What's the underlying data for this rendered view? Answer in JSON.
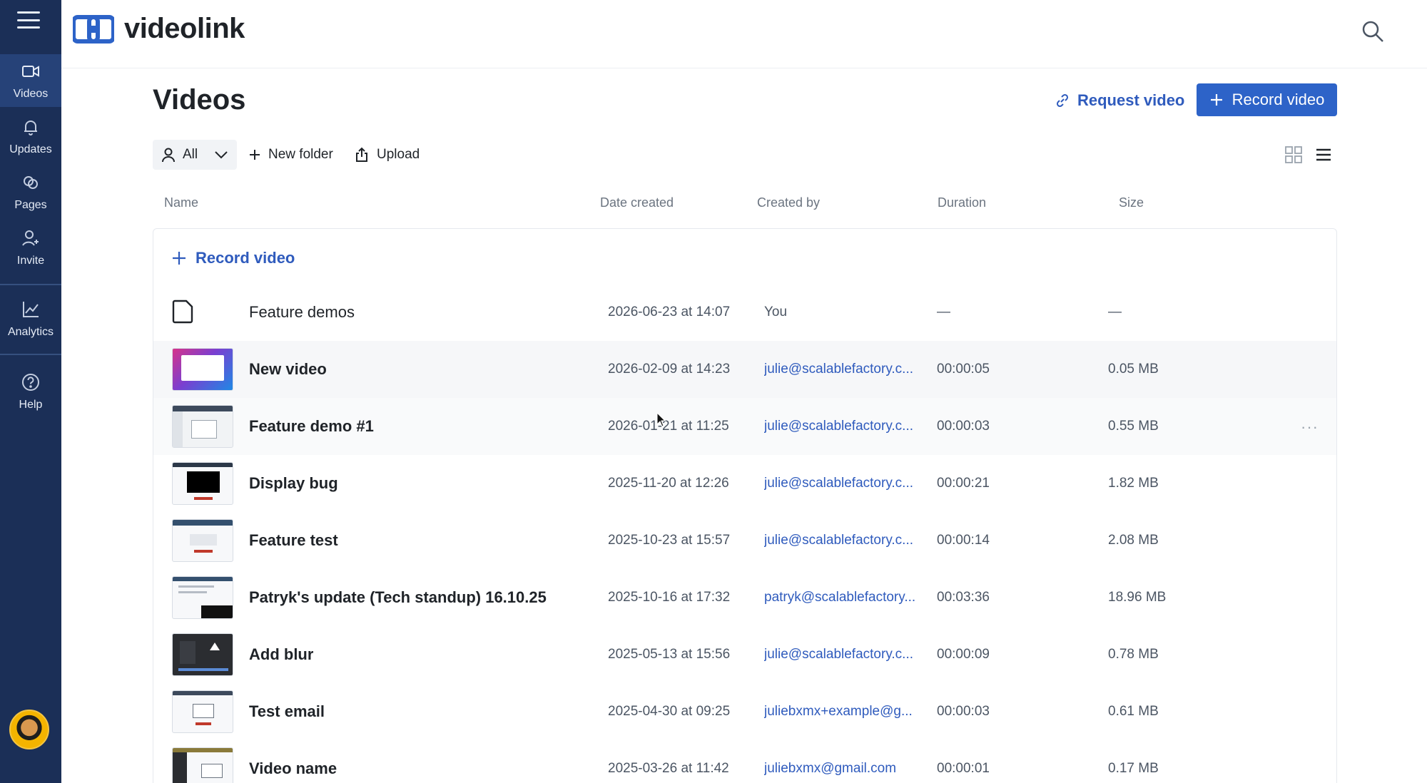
{
  "sidebar": {
    "items": [
      {
        "label": "Videos",
        "icon": "video-camera-icon"
      },
      {
        "label": "Updates",
        "icon": "bell-icon"
      },
      {
        "label": "Pages",
        "icon": "pages-icon"
      },
      {
        "label": "Invite",
        "icon": "invite-user-icon"
      },
      {
        "label": "Analytics",
        "icon": "analytics-chart-icon"
      },
      {
        "label": "Help",
        "icon": "help-circle-icon"
      }
    ],
    "active": "Videos"
  },
  "header": {
    "logo_text": "videolink",
    "search_icon": "search-icon"
  },
  "main": {
    "title": "Videos",
    "request_label": "Request video",
    "record_label": "Record video",
    "filter_value": "All",
    "new_folder_label": "New folder",
    "upload_label": "Upload",
    "columns": {
      "name": "Name",
      "date": "Date created",
      "created_by": "Created by",
      "duration": "Duration",
      "size": "Size"
    },
    "record_row_label": "Record video",
    "rows": [
      {
        "type": "folder",
        "name": "Feature demos",
        "date": "2026-06-23 at 14:07",
        "created_by": "You",
        "duration": "—",
        "size": "—"
      },
      {
        "type": "video",
        "name": "New video",
        "date": "2026-02-09 at 14:23",
        "created_by": "julie@scalablefactory.c...",
        "duration": "00:00:05",
        "size": "0.05 MB"
      },
      {
        "type": "video",
        "name": "Feature demo #1",
        "date": "2026-01-21 at 11:25",
        "created_by": "julie@scalablefactory.c...",
        "duration": "00:00:03",
        "size": "0.55 MB"
      },
      {
        "type": "video",
        "name": "Display bug",
        "date": "2025-11-20 at 12:26",
        "created_by": "julie@scalablefactory.c...",
        "duration": "00:00:21",
        "size": "1.82 MB"
      },
      {
        "type": "video",
        "name": "Feature test",
        "date": "2025-10-23 at 15:57",
        "created_by": "julie@scalablefactory.c...",
        "duration": "00:00:14",
        "size": "2.08 MB"
      },
      {
        "type": "video",
        "name": "Patryk's update (Tech standup) 16.10.25",
        "date": "2025-10-16 at 17:32",
        "created_by": "patryk@scalablefactory...",
        "duration": "00:03:36",
        "size": "18.96 MB"
      },
      {
        "type": "video",
        "name": "Add blur",
        "date": "2025-05-13 at 15:56",
        "created_by": "julie@scalablefactory.c...",
        "duration": "00:00:09",
        "size": "0.78 MB"
      },
      {
        "type": "video",
        "name": "Test email",
        "date": "2025-04-30 at 09:25",
        "created_by": "juliebxmx+example@g...",
        "duration": "00:00:03",
        "size": "0.61 MB"
      },
      {
        "type": "video",
        "name": "Video name",
        "date": "2025-03-26 at 11:42",
        "created_by": "juliebxmx@gmail.com",
        "duration": "00:00:01",
        "size": "0.17 MB"
      }
    ],
    "more_label": "···"
  },
  "colors": {
    "sidebar_bg": "#1b2f57",
    "accent": "#2d63c8",
    "link": "#2f5bbd"
  }
}
